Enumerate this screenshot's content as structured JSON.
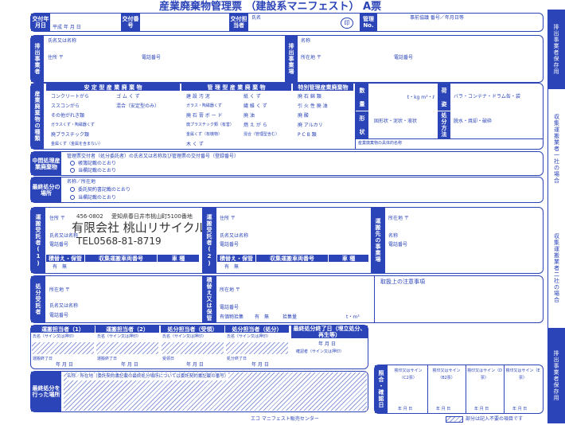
{
  "title": "産業廃棄物管理票 （建設系マニフェスト） A票",
  "top": {
    "issue_date_label": "交付年月日",
    "issue_date_value": "平成 年 月 日",
    "issue_no_label": "交付番号",
    "person_label": "交付担当者",
    "name_label": "氏名",
    "seal": "印",
    "manager_no_label": "管理No.",
    "pre_agreement": "事前協議 番号／年月日等"
  },
  "emitter": {
    "side": "排出事業者",
    "name_label": "氏名又は名称",
    "address_label": "住所 〒",
    "phone_label": "電話番号"
  },
  "site": {
    "side": "排出事業場",
    "name_label": "名称",
    "address_label": "所在地 〒",
    "phone_label": "電話番号"
  },
  "waste": {
    "side": "産業廃棄物の種類",
    "stable_header": "安 定 型 産 業 廃 棄 物",
    "stable_items": [
      "コンクリートがら",
      "ゴ ム く ず",
      "ススコンがら",
      "混合（安定型のみ）",
      "その他がれき類",
      "ガラスくず・陶磁器くず",
      "廃プラスチック類",
      "金属くず（金属を含まない）"
    ],
    "managed_header": "管 理 型 産 業 廃 棄 物",
    "managed_items": [
      "建 設 汚 泥",
      "紙 く ず",
      "ガラス・陶磁器くず",
      "繊 維 く ず",
      "廃 石 膏 ボ ー ド",
      "廃 油",
      "廃プラスチック類（有害）",
      "燃 え が ら",
      "金属くず（有機物）",
      "混合（管理型含む）",
      "木 く ず"
    ],
    "special_header": "特別管理産業廃棄物",
    "special_items": [
      "廃 石 綿 類",
      "引 火 性 廃 油",
      "廃 酸",
      "廃 アルカリ",
      "P C B 類"
    ],
    "qty_label": "数 量",
    "qty_units": "t・kg m³・ℓ",
    "form_label": "形 状",
    "form_value": "固形状・泥状・液状",
    "pack_label": "荷 姿",
    "pack_value": "バラ・コンテナ・ドラム缶・袋",
    "method_label": "処分方法",
    "method_value": "脱水・焼却・破砕",
    "specific_name": "産業廃棄物の具体的名称"
  },
  "intermediate": {
    "label": "中間処理産業廃棄物",
    "text": "管理票交付者（処分委託者）の氏名又は名称及び管理票の交付番号（登録番号）",
    "opt1": "帳簿記載のとおり",
    "opt2": "当欄記載のとおり"
  },
  "final": {
    "label": "最終処分の場所",
    "text": "名称／所在地",
    "opt1": "委託契約書記載のとおり",
    "opt2": "当欄記載のとおり"
  },
  "carrier1": {
    "side": "運搬受託者(1)",
    "address_label": "住所 〒",
    "postal": "456-0802",
    "address_value": "愛知県春日井市桃山町5100番地",
    "name_label": "氏名又は名称",
    "company": "有限会社 桃山リサイクル",
    "phone_label": "電話番号",
    "phone": "TEL0568-81-8719",
    "h1": "積替え・保管",
    "h2": "収集運搬車両番号",
    "h3": "車 種",
    "opts": "有　無"
  },
  "carrier2": {
    "side": "運搬受託者(2)",
    "address_label": "住所 〒",
    "name_label": "氏名又は名称",
    "phone_label": "電話番号",
    "h1": "積替え・保管",
    "h2": "収集運搬車両番号",
    "h3": "車 種",
    "opts": "有　無"
  },
  "dest": {
    "side": "運搬先の事業場",
    "address_label": "所在地 〒",
    "name_label": "名称",
    "phone_label": "電話番号"
  },
  "disposer": {
    "side": "処分受託者",
    "address_label": "所在地 〒",
    "name_label": "氏名又は名称",
    "phone_label": "電話番号"
  },
  "transfer": {
    "side": "積替え又は保管",
    "address_label": "所在地 〒",
    "phone_label": "電話番号",
    "value_label": "有価物拾集",
    "opts": "有　無",
    "qty": "拾集量",
    "unit": "t・m³"
  },
  "notes_label": "取扱上の注意事項",
  "bottom": {
    "carrier1": "運搬担当者（1）",
    "carrier2": "運搬担当者（2）",
    "disp_recv": "処分担当者（受領）",
    "disp_done": "処分担当者（処分）",
    "final_date": "最終処分終了日（埋立処分、再生等）",
    "sign_label": "氏名（サイン又は押印）",
    "carry_date": "運搬終了日",
    "recv_date": "受領日",
    "disp_date": "処分終了日",
    "ymd": "年 月 日",
    "final_sign": "確認者（サイン又は押印）",
    "final_place": "最終処分を行った場所",
    "final_place_text": "名称／所在地（委託契約書記載の最終処分場所については委託契約書記載の番号）",
    "confirm": "照合・確認日",
    "b2": "検印又はサイン（B2票）",
    "b2x": "検印又はサイン（C2票）",
    "d": "検印又はサイン（D票）",
    "e": "検印又はサイン（E票）",
    "legend": "部分は記入不要の項目です",
    "footer": "エコ マニフェスト販売センター"
  },
  "tabs": [
    "排出事業者保存用",
    "収集運搬業者一社の場合",
    "収集運搬業者二社の場合",
    "排出事業者保存用"
  ]
}
